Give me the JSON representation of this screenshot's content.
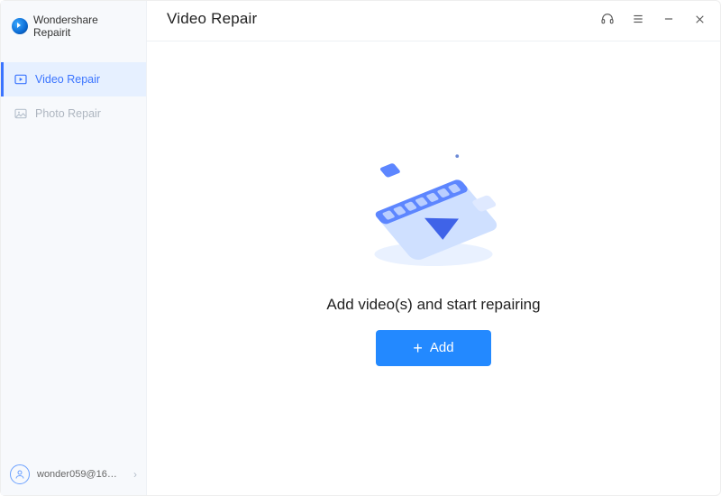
{
  "app": {
    "name": "Wondershare Repairit"
  },
  "titlebar": {
    "page_title": "Video Repair"
  },
  "sidebar": {
    "items": [
      {
        "label": "Video Repair"
      },
      {
        "label": "Photo Repair"
      }
    ],
    "footer": {
      "username": "wonder059@16…"
    }
  },
  "content": {
    "prompt": "Add video(s) and start repairing",
    "add_label": "Add"
  },
  "icons": {
    "play": "play-icon",
    "photo": "photo-icon",
    "user": "user-icon",
    "support": "headset-icon",
    "menu": "hamburger-icon",
    "minimize": "minimize-icon",
    "close": "close-icon",
    "plus": "plus-icon",
    "chevron": "chevron-right-icon"
  },
  "colors": {
    "accent": "#2389ff",
    "active_bg": "#e6f0ff"
  }
}
